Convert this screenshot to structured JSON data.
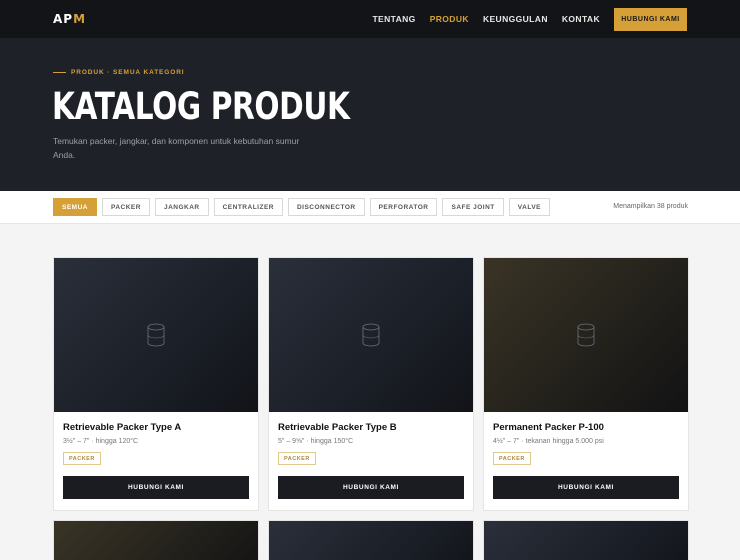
{
  "header": {
    "logo_a": "AP",
    "logo_b": "M",
    "nav": [
      {
        "label": "TENTANG",
        "active": false
      },
      {
        "label": "PRODUK",
        "active": true
      },
      {
        "label": "KEUNGGULAN",
        "active": false
      },
      {
        "label": "KONTAK",
        "active": false
      }
    ],
    "cta": "HUBUNGI KAMI"
  },
  "hero": {
    "breadcrumb": "PRODUK · SEMUA KATEGORI",
    "title": "KATALOG PRODUK",
    "subtitle": "Temukan packer, jangkar, dan komponen untuk kebutuhan sumur Anda."
  },
  "filters": {
    "chips": [
      {
        "label": "SEMUA",
        "active": true
      },
      {
        "label": "PACKER",
        "active": false
      },
      {
        "label": "JANGKAR",
        "active": false
      },
      {
        "label": "CENTRALIZER",
        "active": false
      },
      {
        "label": "DISCONNECTOR",
        "active": false
      },
      {
        "label": "PERFORATOR",
        "active": false
      },
      {
        "label": "SAFE JOINT",
        "active": false
      },
      {
        "label": "VALVE",
        "active": false
      }
    ],
    "count_text": "Menampilkan 38 produk"
  },
  "products": [
    {
      "title": "Retrievable Packer Type A",
      "spec": "3½\" – 7\" · hingga 120°C",
      "tag": "PACKER",
      "button": "HUBUNGI KAMI"
    },
    {
      "title": "Retrievable Packer Type B",
      "spec": "5\" – 9⅝\" · hingga 150°C",
      "tag": "PACKER",
      "button": "HUBUNGI KAMI"
    },
    {
      "title": "Permanent Packer P-100",
      "spec": "4½\" – 7\" · tekanan hingga 5.000 psi",
      "tag": "PACKER",
      "button": "HUBUNGI KAMI"
    }
  ],
  "colors": {
    "accent": "#d4a037",
    "dark": "#1e2128"
  }
}
